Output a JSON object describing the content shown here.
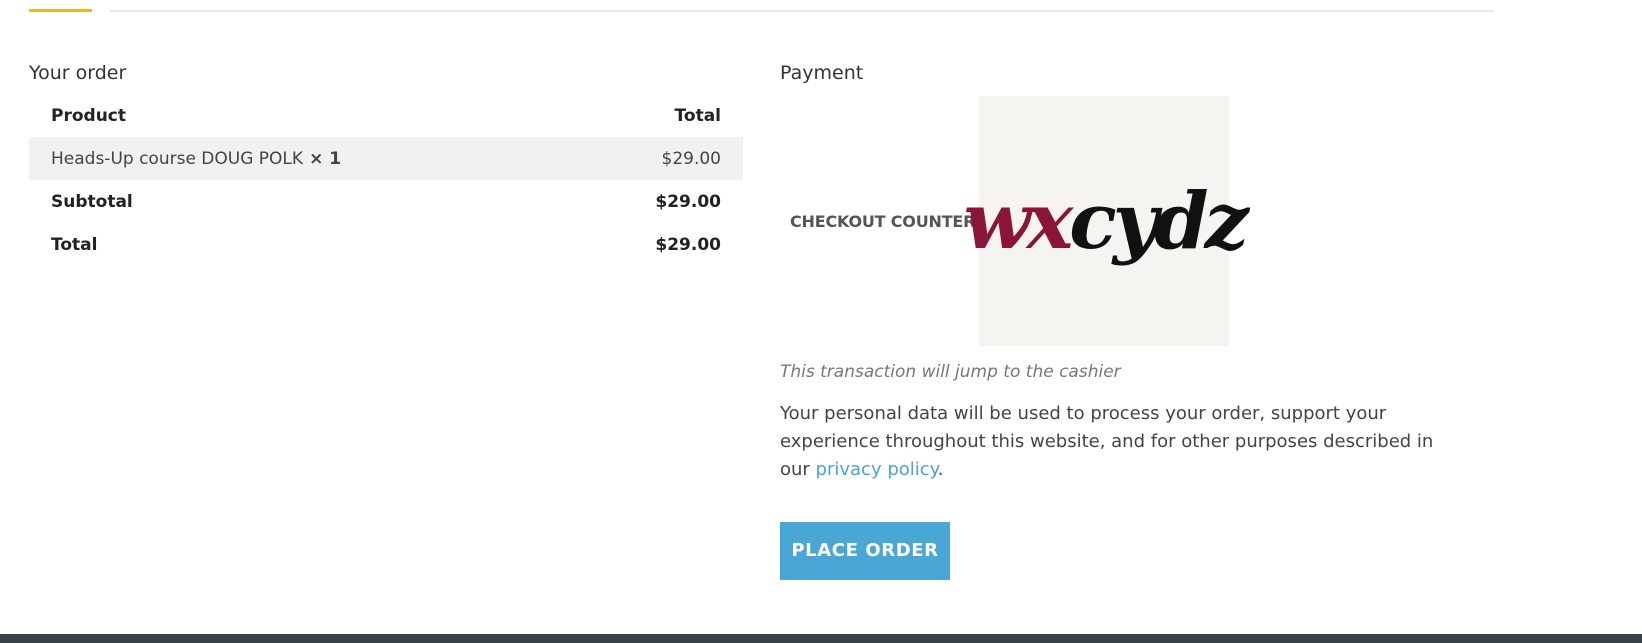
{
  "order": {
    "title": "Your order",
    "headers": {
      "product": "Product",
      "total": "Total"
    },
    "item": {
      "name": "Heads-Up course DOUG POLK",
      "quantity": "× 1",
      "total": "$29.00"
    },
    "subtotal": {
      "label": "Subtotal",
      "value": "$29.00"
    },
    "grand_total": {
      "label": "Total",
      "value": "$29.00"
    }
  },
  "payment": {
    "title": "Payment",
    "gateway_label": "CHECKOUT COUNTER",
    "logo_text_red": "wx",
    "logo_text_black": "cydz",
    "note": "This transaction will jump to the cashier",
    "privacy_text": "Your personal data will be used to process your order, support your experience throughout this website, and for other purposes described in our ",
    "privacy_link": "privacy policy",
    "privacy_end": ".",
    "place_order": "PLACE ORDER"
  },
  "colors": {
    "accent": "#e8b923",
    "button": "#4aa6d4",
    "link": "#4aa3d0",
    "footer": "#3b4148"
  }
}
